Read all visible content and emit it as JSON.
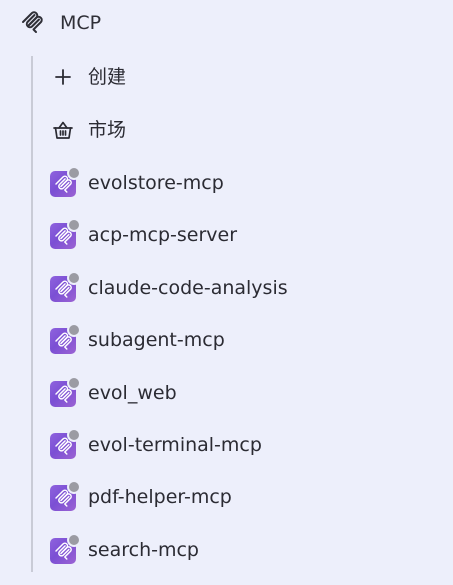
{
  "header": {
    "title": "MCP",
    "icon": "mcp-logo-icon"
  },
  "actions": [
    {
      "label": "创建",
      "icon": "plus-icon"
    },
    {
      "label": "市场",
      "icon": "basket-icon"
    }
  ],
  "servers": [
    {
      "name": "evolstore-mcp",
      "status": "offline"
    },
    {
      "name": "acp-mcp-server",
      "status": "offline"
    },
    {
      "name": "claude-code-analysis",
      "status": "offline"
    },
    {
      "name": "subagent-mcp",
      "status": "offline"
    },
    {
      "name": "evol_web",
      "status": "offline"
    },
    {
      "name": "evol-terminal-mcp",
      "status": "offline"
    },
    {
      "name": "pdf-helper-mcp",
      "status": "offline"
    },
    {
      "name": "search-mcp",
      "status": "offline"
    }
  ],
  "colors": {
    "background": "#edeffb",
    "server_icon": "#8a5ad9",
    "status_offline": "#9b9ba3",
    "tree_line": "#c9cbd6"
  }
}
